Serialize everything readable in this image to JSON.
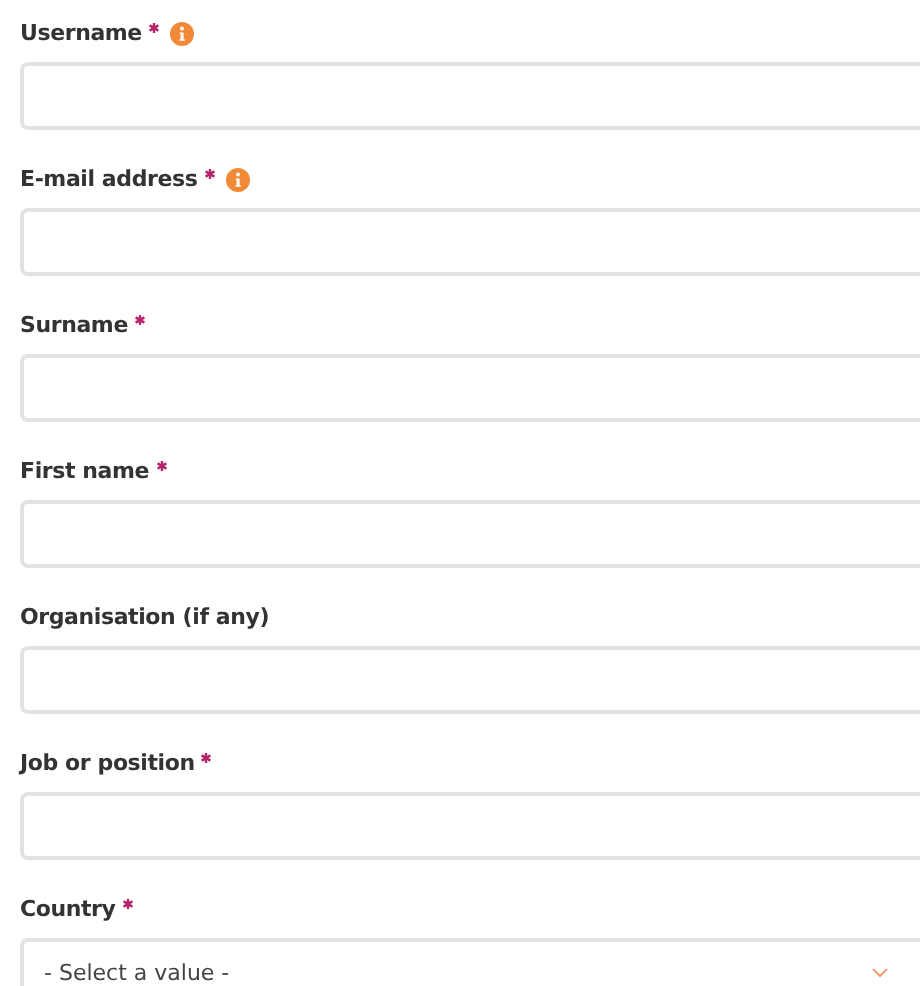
{
  "fields": [
    {
      "kind": "text",
      "label": "Username",
      "required": true,
      "info": true
    },
    {
      "kind": "text",
      "label": "E-mail address",
      "required": true,
      "info": true
    },
    {
      "kind": "text",
      "label": "Surname",
      "required": true,
      "info": false
    },
    {
      "kind": "text",
      "label": "First name",
      "required": true,
      "info": false
    },
    {
      "kind": "text",
      "label": "Organisation (if any)",
      "required": false,
      "info": false
    },
    {
      "kind": "text",
      "label": "Job or position",
      "required": true,
      "info": false
    },
    {
      "kind": "select",
      "label": "Country",
      "required": true,
      "info": false,
      "value": "- Select a value -"
    }
  ]
}
